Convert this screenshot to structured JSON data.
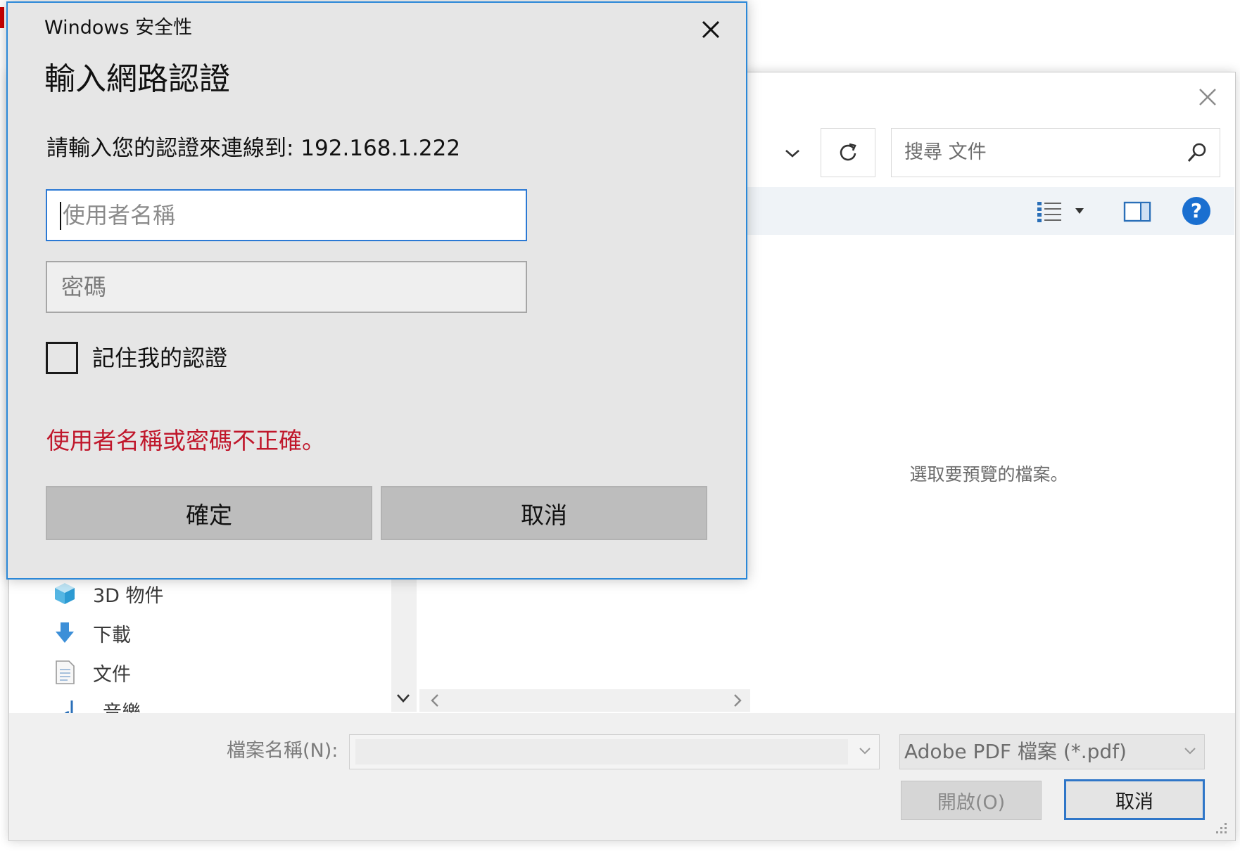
{
  "security_dialog": {
    "app_title": "Windows 安全性",
    "heading": "輸入網路認證",
    "message": "請輸入您的認證來連線到: 192.168.1.222",
    "username_placeholder": "使用者名稱",
    "password_placeholder": "密碼",
    "remember_label": "記住我的認證",
    "remember_checked": false,
    "error_text": "使用者名稱或密碼不正確。",
    "ok_label": "確定",
    "cancel_label": "取消",
    "accent_color": "#2b88d8",
    "error_color": "#c0172b"
  },
  "file_dialog": {
    "search_placeholder": "搜尋 文件",
    "preview_text": "選取要預覽的檔案。",
    "nav_items": [
      {
        "label": "3D 物件",
        "icon": "cube-3d-icon"
      },
      {
        "label": "下載",
        "icon": "download-arrow-icon"
      },
      {
        "label": "文件",
        "icon": "document-icon"
      },
      {
        "label": "音樂",
        "icon": "music-note-icon"
      }
    ],
    "filename_label": "檔案名稱(N):",
    "filename_value": "",
    "filetype_selected": "Adobe PDF 檔案 (*.pdf)",
    "open_label": "開啟(O)",
    "cancel_label": "取消",
    "help_icon_text": "?"
  }
}
